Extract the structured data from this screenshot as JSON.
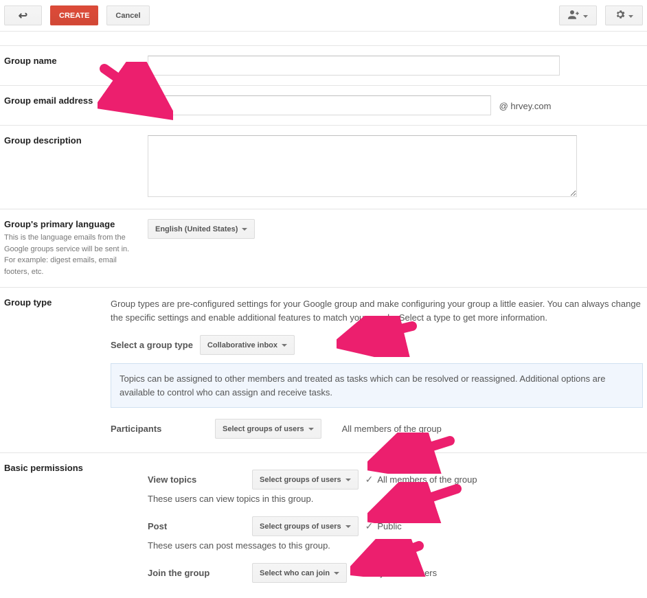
{
  "toolbar": {
    "create_label": "CREATE",
    "cancel_label": "Cancel"
  },
  "fields": {
    "group_name": {
      "label": "Group name",
      "value": ""
    },
    "group_email": {
      "label": "Group email address",
      "value": "",
      "suffix": "@ hrvey.com"
    },
    "group_description": {
      "label": "Group description",
      "value": ""
    },
    "primary_language": {
      "label": "Group's primary language",
      "sublabel": "This is the language emails from the Google groups service will be sent in. For example: digest emails, email footers, etc.",
      "selected": "English (United States)"
    },
    "group_type": {
      "label": "Group type",
      "description": "Group types are pre-configured settings for your Google group and make configuring your group a little easier. You can always change the specific settings and enable additional features to match your needs. Select a type to get more information.",
      "select_label": "Select a group type",
      "selected": "Collaborative inbox",
      "info": "Topics can be assigned to other members and treated as tasks which can be resolved or reassigned. Additional options are available to control who can assign and receive tasks.",
      "participants": {
        "label": "Participants",
        "dropdown": "Select groups of users",
        "value": "All members of the group"
      }
    },
    "basic_permissions": {
      "label": "Basic permissions",
      "view_topics": {
        "label": "View topics",
        "dropdown": "Select groups of users",
        "value": "All members of the group",
        "help": "These users can view topics in this group."
      },
      "post": {
        "label": "Post",
        "dropdown": "Select groups of users",
        "value": "Public",
        "help": "These users can post messages to this group."
      },
      "join": {
        "label": "Join the group",
        "dropdown": "Select who can join",
        "value": "Only invited users"
      }
    }
  },
  "arrow_color": "#ec1f6e"
}
